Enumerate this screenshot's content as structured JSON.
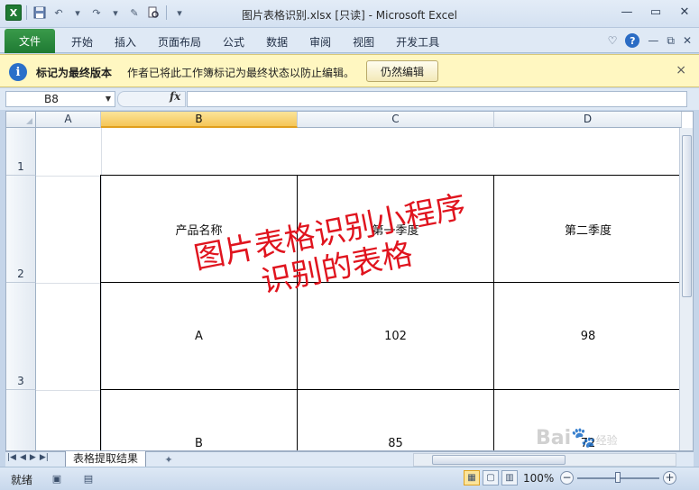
{
  "window": {
    "title": "图片表格识别.xlsx  [只读] - Microsoft Excel",
    "app_icon": "X"
  },
  "ribbon": {
    "file_tab": "文件",
    "tabs": [
      "开始",
      "插入",
      "页面布局",
      "公式",
      "数据",
      "审阅",
      "视图",
      "开发工具"
    ],
    "help": "?"
  },
  "message_bar": {
    "title": "标记为最终版本",
    "text": "作者已将此工作簿标记为最终状态以防止编辑。",
    "button": "仍然编辑",
    "close": "×"
  },
  "formula_bar": {
    "name_box": "B8",
    "fx": "fx",
    "formula": ""
  },
  "sheet": {
    "columns": [
      "A",
      "B",
      "C",
      "D"
    ],
    "selected_column": "B",
    "rows": [
      "1",
      "2",
      "3"
    ],
    "table": {
      "header": [
        "产品名称",
        "第一季度",
        "第二季度"
      ],
      "rows": [
        [
          "A",
          "102",
          "98"
        ],
        [
          "B",
          "85",
          "72"
        ]
      ]
    },
    "watermark": [
      "图片表格识别小程序",
      "识别的表格"
    ]
  },
  "sheet_tabs": {
    "active": "表格提取结果"
  },
  "status_bar": {
    "ready": "就绪",
    "zoom": "100%"
  },
  "overlay": {
    "baidu": "Bai",
    "baidu_suffix": "经验"
  }
}
